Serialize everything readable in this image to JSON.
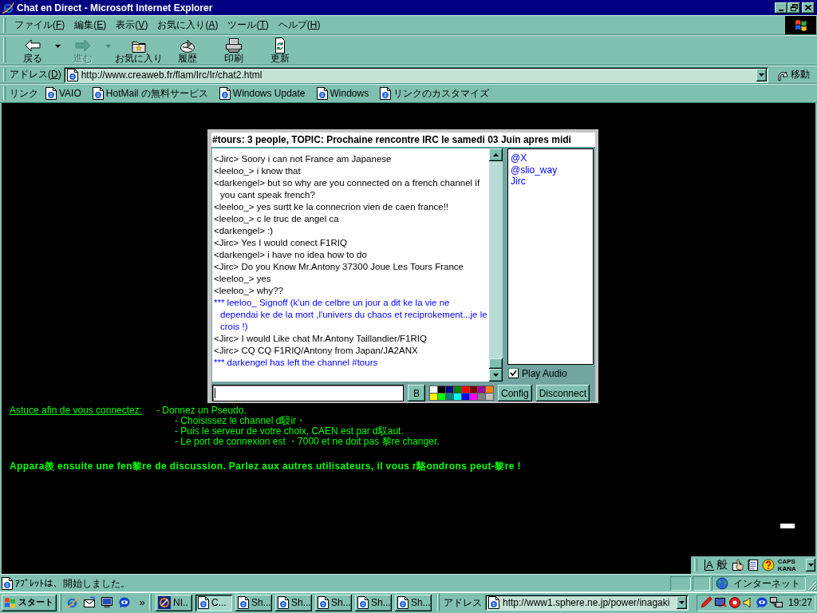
{
  "window": {
    "title": "Chat en Direct - Microsoft Internet Explorer"
  },
  "menu_bar": {
    "items": [
      "ファイル(F)",
      "編集(E)",
      "表示(V)",
      "お気に入り(A)",
      "ツール(T)",
      "ヘルプ(H)"
    ]
  },
  "toolbar": {
    "buttons": [
      {
        "kind": "back",
        "label": "戻る",
        "disabled": false,
        "dropdown": true
      },
      {
        "kind": "forward",
        "label": "進む",
        "disabled": true,
        "dropdown": true
      },
      {
        "kind": "favorites",
        "label": "お気に入り",
        "disabled": false,
        "dropdown": false
      },
      {
        "kind": "history",
        "label": "履歴",
        "disabled": false,
        "dropdown": false
      },
      {
        "kind": "print",
        "label": "印刷",
        "disabled": false,
        "dropdown": false
      },
      {
        "kind": "refresh",
        "label": "更新",
        "disabled": false,
        "dropdown": false
      }
    ]
  },
  "address_bar": {
    "label": "アドレス(D)",
    "url": "http://www.creaweb.fr/flam/Irc/Ir/chat2.html",
    "go_button": "移動"
  },
  "links_bar": {
    "label": "リンク",
    "links": [
      "VAIO",
      "HotMail の無料サービス",
      "Windows Update",
      "Windows",
      "リンクのカスタマイズ"
    ]
  },
  "chat": {
    "topic": "#tours: 3 people, TOPIC: Prochaine rencontre IRC le samedi 03 Juin apres midi",
    "messages": [
      {
        "kind": "message",
        "text": "<Jirc> Soory i can not France am Japanese"
      },
      {
        "kind": "message",
        "text": "<leeloo_> i know that"
      },
      {
        "kind": "message",
        "text": "<darkengel> but so why are you connected on a french channel if you cant speak french?"
      },
      {
        "kind": "message",
        "text": "<leeloo_> yes surtt ke la connecrion vien de caen france!!"
      },
      {
        "kind": "message",
        "text": "<leeloo_> c le truc de angel ca"
      },
      {
        "kind": "message",
        "text": "<darkengel> :)"
      },
      {
        "kind": "message",
        "text": "<Jirc> Yes I would conect F1RIQ"
      },
      {
        "kind": "message",
        "text": "<darkengel> i have no idea how to do"
      },
      {
        "kind": "message",
        "text": "<Jirc> Do you Know Mr.Antony 37300 Joue Les Tours France"
      },
      {
        "kind": "message",
        "text": "<leeloo_> yes"
      },
      {
        "kind": "message",
        "text": "<leeloo_> why??"
      },
      {
        "kind": "notice",
        "text": "*** leeloo_ Signoff (k'un de celbre un jour a dit ke la vie ne dependai ke de la mort ,l'univers du chaos et reciprokement...je le crois !)"
      },
      {
        "kind": "message",
        "text": "<Jirc> I would Like chat Mr.Antony Taillandier/F1RIQ"
      },
      {
        "kind": "message",
        "text": "<Jirc> CQ CQ F1RIQ/Antony from Japan/JA2ANX"
      },
      {
        "kind": "notice",
        "text": "*** darkengel has left the channel #tours"
      }
    ],
    "users": [
      "@X",
      "@slio_way",
      "Jirc"
    ],
    "play_audio": {
      "label": "Play Audio",
      "checked": true
    },
    "bold_button": "B",
    "palette": [
      {
        "color": "#ffffff"
      },
      {
        "color": "#000000"
      },
      {
        "color": "#000080"
      },
      {
        "color": "#008000"
      },
      {
        "color": "#ff0000"
      },
      {
        "color": "#800000"
      },
      {
        "color": "#a000a0"
      },
      {
        "color": "#ff8000"
      },
      {
        "color": "#ffff00"
      },
      {
        "color": "#00ff00"
      },
      {
        "color": "#008080"
      },
      {
        "color": "#00ffff"
      },
      {
        "color": "#0000ff"
      },
      {
        "color": "#ff00ff"
      },
      {
        "color": "#808080"
      },
      {
        "color": "#c0c0c0"
      }
    ],
    "buttons": [
      "Config",
      "Disconnect"
    ]
  },
  "page": {
    "hint_link": "Astuce afin de vous connectez:",
    "hints": [
      "- Donnez un Pseudo.",
      "- Choisissez le channel d駸ir・",
      "- Puis le serveur de votre choix, CAEN est par d馭aut.",
      "- Le port de connexion est ・7000 et ne doit pas 黎re changer."
    ],
    "notice": "Appara羨 ensuite une fen黎re de discussion. Parlez aux autres utilisateurs, il vous r駱ondrons peut-黎re !"
  },
  "ime_toolbar": {
    "input_mode": "A",
    "conversion_mode": "般",
    "caps": "CAPS",
    "kana": "KANA"
  },
  "status_bar": {
    "text": "ｱﾌﾟﾚｯﾄは、開始しました。",
    "zone": "インターネット"
  },
  "taskbar": {
    "start": "スタート",
    "more": "»",
    "tasks": [
      {
        "kind": "tile",
        "label": "NI..",
        "selected": false
      },
      {
        "kind": "page",
        "label": "C...",
        "selected": true
      },
      {
        "kind": "page",
        "label": "Sh...",
        "selected": false
      },
      {
        "kind": "page",
        "label": "Sh...",
        "selected": false
      },
      {
        "kind": "page",
        "label": "Sh...",
        "selected": false
      },
      {
        "kind": "page",
        "label": "Sh...",
        "selected": false
      },
      {
        "kind": "page",
        "label": "Sh...",
        "selected": false
      }
    ],
    "address_label": "アドレス",
    "address_url": "http://www1.sphere.ne.jp/power/inagaki",
    "clock": "19:27"
  }
}
